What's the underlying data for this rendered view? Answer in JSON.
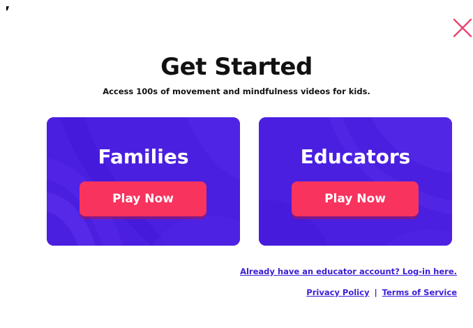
{
  "modal": {
    "title": "Get Started",
    "subtitle": "Access 100s of movement and mindfulness videos for kids."
  },
  "cards": [
    {
      "title": "Families",
      "button_label": "Play Now"
    },
    {
      "title": "Educators",
      "button_label": "Play Now"
    }
  ],
  "footer": {
    "login_link": "Already have an educator account? Log-in here.",
    "privacy_link": "Privacy Policy",
    "separator": "|",
    "terms_link": "Terms of Service"
  },
  "colors": {
    "card_bg": "#4a1fe0",
    "button_bg": "#f7335e",
    "link": "#3a1fd6",
    "close_icon": "#e8456e"
  },
  "icons": {
    "close": "close-icon"
  }
}
